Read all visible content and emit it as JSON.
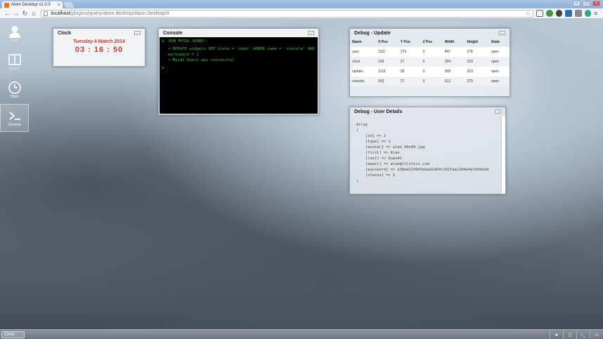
{
  "browser": {
    "tab_title": "Atom Desktop v1.0.0",
    "tab_close": "×",
    "win_minimize": "–",
    "win_maximize": "□",
    "win_close": "×",
    "url_host": "localhost",
    "url_path": "/plugins/jquery/atom.desktop/Atom.Desktop/#"
  },
  "dock": {
    "items": [
      {
        "label": "user",
        "icon": "user-icon"
      },
      {
        "label": "Update",
        "icon": "panels-icon"
      },
      {
        "label": "Clock",
        "icon": "clock-icon"
      },
      {
        "label": "Console",
        "icon": "terminal-icon"
      }
    ]
  },
  "clock": {
    "title": "Clock",
    "date": "Tuesday 4 March 2014",
    "time": "03 : 16 : 50"
  },
  "console": {
    "title": "Console",
    "command": "$: RUN MYSQL QUERY:",
    "lines": [
      "UPDATE widgets SET state = 'open' WHERE name = 'console' AND workspace = 1",
      "Mysql Query was successful"
    ],
    "prompt": "$:_"
  },
  "debug_update": {
    "title": "Debug - Update",
    "columns": [
      "Name",
      "X Pos",
      "Y Pos",
      "Z Pos",
      "Width",
      "Height",
      "State"
    ],
    "rows": [
      [
        "user",
        "1111",
        "279",
        "0",
        "497",
        "278",
        "open"
      ],
      [
        "clock",
        "169",
        "27",
        "0",
        "294",
        "123",
        "open"
      ],
      [
        "update",
        "1113",
        "28",
        "0",
        "508",
        "219",
        "open"
      ],
      [
        "console",
        "503",
        "27",
        "0",
        "512",
        "279",
        "open"
      ]
    ]
  },
  "debug_user": {
    "title": "Debug - User Details",
    "text": "Array\n(\n    [id] => 2\n    [type] => 1\n    [avatar] => alan_60x60.jpg\n    [first] => Alan\n    [last] => Quandt\n    [email] => alan@rtlstics.com\n    [password] => e38ad214943daad1d64c102faec29de4afe9da3d\n    [status] => 1\n)"
  },
  "taskbar": {
    "task_label": "Clock"
  }
}
